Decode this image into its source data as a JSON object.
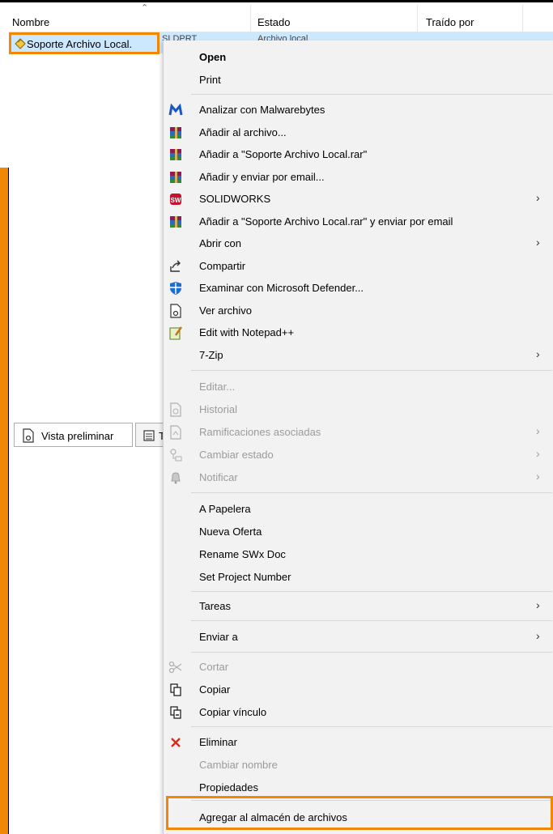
{
  "header": {
    "col_nombre": "Nombre",
    "col_estado": "Estado",
    "col_traido": "Traído por"
  },
  "file": {
    "name": "Soporte Archivo Local.",
    "ext_partial": "SLDPRT",
    "state_partial": "Archivo local"
  },
  "tabs": {
    "preview": "Vista preliminar",
    "second": "T"
  },
  "menu": {
    "open": "Open",
    "print": "Print",
    "malwarebytes": "Analizar con Malwarebytes",
    "add_archive": "Añadir al archivo...",
    "add_rar": "Añadir a \"Soporte Archivo Local.rar\"",
    "add_email": "Añadir y enviar por email...",
    "solidworks": "SOLIDWORKS",
    "add_rar_email": "Añadir a \"Soporte Archivo Local.rar\" y enviar por email",
    "open_with": "Abrir con",
    "share": "Compartir",
    "defender": "Examinar con Microsoft Defender...",
    "view_file": "Ver archivo",
    "notepad": "Edit with Notepad++",
    "zip": "7-Zip",
    "edit": "Editar...",
    "history": "Historial",
    "branches": "Ramificaciones asociadas",
    "change_state": "Cambiar estado",
    "notify": "Notificar",
    "trash": "A Papelera",
    "new_offer": "Nueva Oferta",
    "rename_swx": "Rename SWx Doc",
    "set_project": "Set Project Number",
    "tasks": "Tareas",
    "send_to": "Enviar a",
    "cut": "Cortar",
    "copy": "Copiar",
    "copy_link": "Copiar vínculo",
    "delete": "Eliminar",
    "rename": "Cambiar nombre",
    "properties": "Propiedades",
    "add_vault": "Agregar al almacén de archivos",
    "submenu_arrow": "›"
  },
  "colors": {
    "highlight": "#f28705",
    "selection": "#cce8ff",
    "menu_bg": "#f2f2f2",
    "disabled_text": "#9b9b9b"
  }
}
